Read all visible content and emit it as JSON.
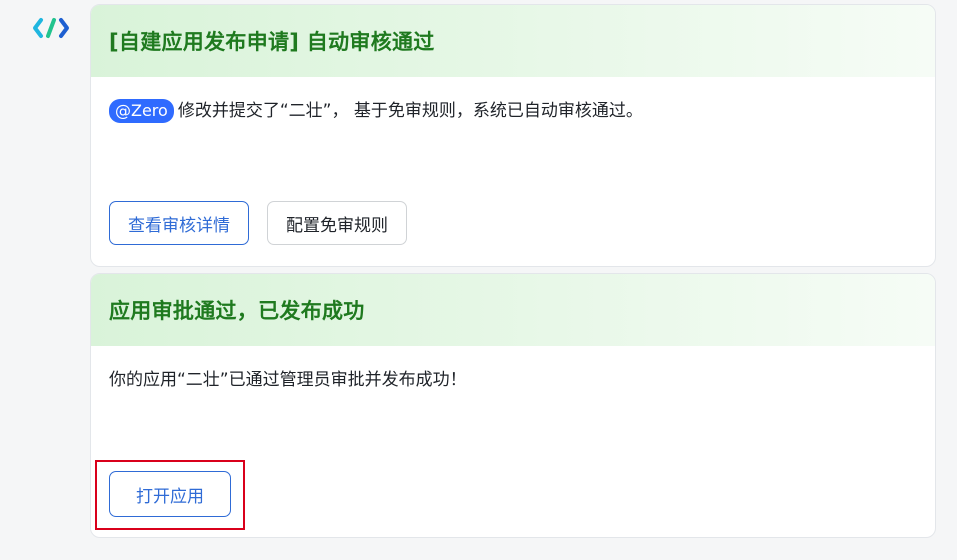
{
  "logo": {
    "icon": "brackets-logo-icon",
    "color_left": "#1fb6e0",
    "color_right": "#1d5fd1",
    "slash_color": "#22c38e"
  },
  "card1": {
    "title": "[自建应用发布申请] 自动审核通过",
    "mention": "@Zero",
    "body": "修改并提交了“二壮”， 基于免审规则，系统已自动审核通过。",
    "buttons": {
      "view_details": "查看审核详情",
      "configure_rules": "配置免审规则"
    }
  },
  "card2": {
    "title": "应用审批通过，已发布成功",
    "body": "你的应用“二壮”已通过管理员审批并发布成功！",
    "buttons": {
      "open_app": "打开应用"
    }
  },
  "colors": {
    "header_green_text": "#1f7a1f",
    "header_bg": "#d9f3d9",
    "primary_blue": "#2f6bd6",
    "mention_blue": "#2f6bff",
    "highlight_red": "#d9001b"
  }
}
